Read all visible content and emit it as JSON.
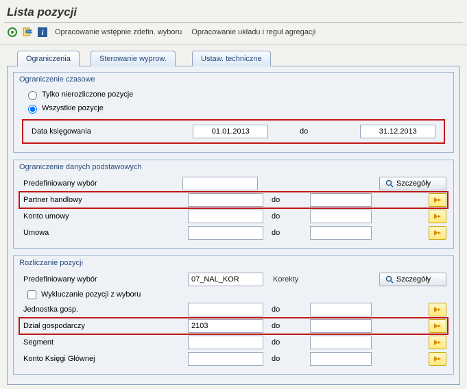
{
  "title": "Lista pozycji",
  "toolbar": {
    "exec_icon": "execute-icon",
    "variant_icon": "get-variant-icon",
    "info_icon": "info-icon",
    "link_predef": "Opracowanie wstępnie zdefin. wyboru",
    "link_layout": "Opracowanie układu i reguł agregacji"
  },
  "tabs": {
    "t1": "Ograniczenia",
    "t2": "Sterowanie wyprow.",
    "t3": "Ustaw. techniczne"
  },
  "group_time": {
    "title": "Ograniczenie czasowe",
    "radio_open": "Tylko nierozliczone pozycje",
    "radio_all": "Wszystkie pozycje",
    "posting_date_label": "Data księgowania",
    "posting_date_from": "01.01.2013",
    "to": "do",
    "posting_date_to": "31.12.2013"
  },
  "group_master": {
    "title": "Ograniczenie danych podstawowych",
    "predef_label": "Predefiniowany wybór",
    "predef_value": "",
    "details_btn": "Szczegóły",
    "partner_label": "Partner handlowy",
    "partner_from": "",
    "partner_to": "",
    "to": "do",
    "caccount_label": "Konto umowy",
    "caccount_from": "",
    "caccount_to": "",
    "contract_label": "Umowa",
    "contract_from": "",
    "contract_to": ""
  },
  "group_clearing": {
    "title": "Rozliczanie pozycji",
    "predef_label": "Predefiniowany wybór",
    "predef_value": "07_NAL_KOR",
    "predef_text": "Korekty",
    "details_btn": "Szczegóły",
    "exclude_label": "Wykluczanie pozycji z wyboru",
    "to": "do",
    "cocd_label": "Jednostka gosp.",
    "cocd_from": "",
    "cocd_to": "",
    "busarea_label": "Dział gospodarczy",
    "busarea_from": "2103",
    "busarea_to": "",
    "segment_label": "Segment",
    "segment_from": "",
    "segment_to": "",
    "gl_label": "Konto Księgi Głównej",
    "gl_from": "",
    "gl_to": ""
  }
}
